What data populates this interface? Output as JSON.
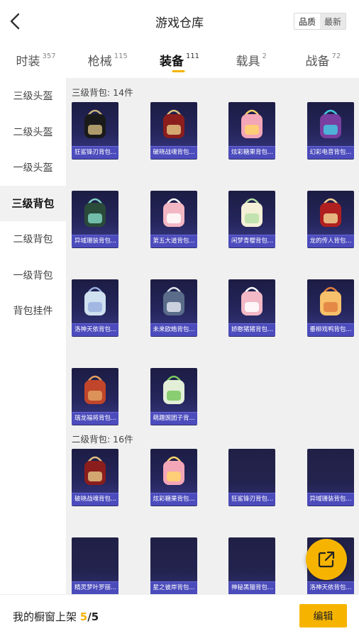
{
  "header": {
    "title": "游戏仓库",
    "sort_options": [
      "品质",
      "最新"
    ]
  },
  "tabs": [
    {
      "label": "时装",
      "count": "357"
    },
    {
      "label": "枪械",
      "count": "115"
    },
    {
      "label": "装备",
      "count": "111"
    },
    {
      "label": "载具",
      "count": "2"
    },
    {
      "label": "战备",
      "count": "72"
    }
  ],
  "sidebar": [
    "三级头盔",
    "二级头盔",
    "一级头盔",
    "三级背包",
    "二级背包",
    "一级背包",
    "背包挂件"
  ],
  "sections": [
    {
      "title": "三级背包: 14件",
      "items": [
        "狂鲨锋刃背包...",
        "破晓战魂背包...",
        "炫彩糖果背包...",
        "幻彩电音背包...",
        "异域珊装背包...",
        "第五大道背包...",
        "闲梦青樱背包...",
        "龙的传人背包...",
        "洛神天依背包...",
        "未来欧皓背包...",
        "娇憨猪猪背包...",
        "垂柳戏鸭背包...",
        "瑞龙福将背包...",
        "萌趣豌团子背..."
      ]
    },
    {
      "title": "二级背包: 16件",
      "items": [
        "破晓战魂背包...",
        "炫彩糖果背包...",
        "狂鲨锋刃背包...",
        "异域珊装背包...",
        "精灵梦叶罗丽...",
        "星之彼岸背包...",
        "神秘黑猫背包...",
        "洛神天依背包..."
      ]
    }
  ],
  "bottom": {
    "label": "我的橱窗上架",
    "current": "5",
    "separator": "/",
    "total": "5",
    "edit_label": "编辑"
  },
  "colors": {
    "accent": "#f6b400",
    "card_bg": "#25265c",
    "card_caption": "#5050c8"
  }
}
